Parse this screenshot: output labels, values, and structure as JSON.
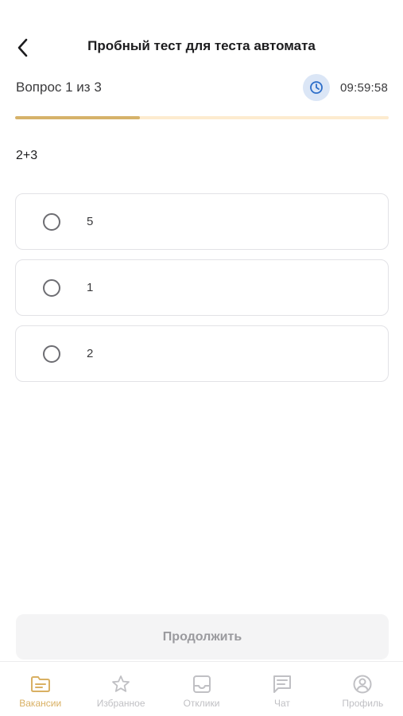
{
  "header": {
    "title": "Пробный тест для теста автомата"
  },
  "progress": {
    "counter_text": "Вопрос 1 из 3",
    "timer": "09:59:58",
    "fraction": 0.333,
    "color_fill": "#d6b26a",
    "color_track": "#fdebcf"
  },
  "question": {
    "text": "2+3",
    "options": [
      {
        "label": "5",
        "selected": false
      },
      {
        "label": "1",
        "selected": false
      },
      {
        "label": "2",
        "selected": false
      }
    ]
  },
  "actions": {
    "continue_label": "Продолжить"
  },
  "tabbar": {
    "accent_color": "#d9b063",
    "items": [
      {
        "label": "Вакансии",
        "icon": "folder-icon",
        "active": true
      },
      {
        "label": "Избранное",
        "icon": "star-icon",
        "active": false
      },
      {
        "label": "Отклики",
        "icon": "inbox-icon",
        "active": false
      },
      {
        "label": "Чат",
        "icon": "chat-icon",
        "active": false
      },
      {
        "label": "Профиль",
        "icon": "profile-icon",
        "active": false
      }
    ]
  }
}
